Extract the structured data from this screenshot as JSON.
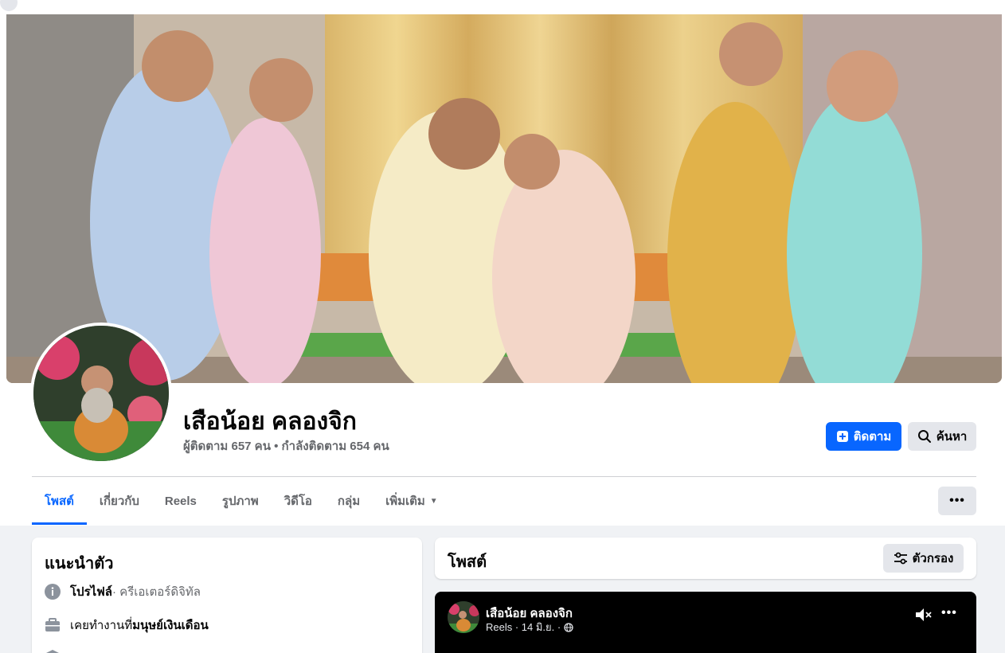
{
  "profile": {
    "name": "เสือน้อย คลองจิก",
    "stats": "ผู้ติดตาม 657 คน • กำลังติดตาม 654 คน"
  },
  "actions": {
    "follow_label": "ติดตาม",
    "search_label": "ค้นหา",
    "more_label": "•••"
  },
  "tabs": [
    {
      "label": "โพสต์"
    },
    {
      "label": "เกี่ยวกับ"
    },
    {
      "label": "Reels"
    },
    {
      "label": "รูปภาพ"
    },
    {
      "label": "วิดีโอ"
    },
    {
      "label": "กลุ่ม"
    },
    {
      "label": "เพิ่มเติม"
    }
  ],
  "intro": {
    "title": "แนะนำตัว",
    "rows": [
      {
        "icon": "info-icon",
        "bold": "โปรไฟล์",
        "text": " · ครีเอเตอร์ดิจิทัล"
      },
      {
        "icon": "briefcase-icon",
        "text": "เคยทำงานที่ ",
        "bold": "มนุษย์เงินเดือน"
      },
      {
        "icon": "graduation-cap-icon",
        "text": "",
        "bold": ""
      }
    ]
  },
  "posts": {
    "title": "โพสต์",
    "filter_label": "ตัวกรอง"
  },
  "reel": {
    "author": "เสือน้อย คลองจิก",
    "meta": "Reels · 14 มิ.ย. ·",
    "more_label": "•••"
  },
  "colors": {
    "accent": "#0866ff",
    "page_bg": "#f0f2f5",
    "secondary_text": "#65676b",
    "button_grey": "#e4e6eb"
  }
}
